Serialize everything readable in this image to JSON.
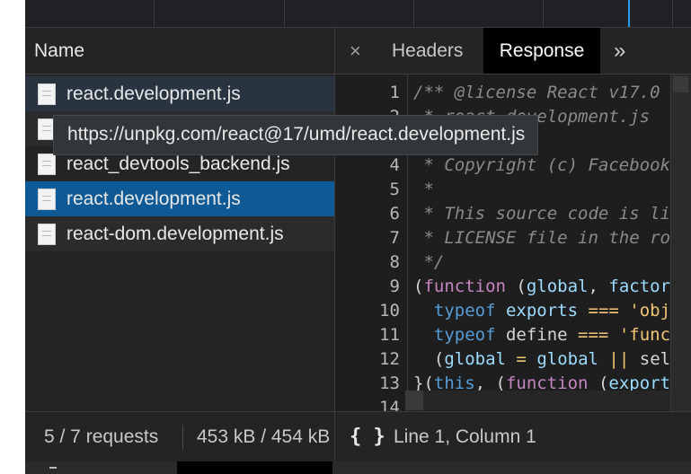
{
  "header": {
    "name_column": "Name"
  },
  "requests": [
    {
      "name": "react.development.js",
      "state": "hover"
    },
    {
      "name": "",
      "state": "normal"
    },
    {
      "name": "react_devtools_backend.js",
      "state": "normal"
    },
    {
      "name": "react.development.js",
      "state": "selected"
    },
    {
      "name": "react-dom.development.js",
      "state": "normal"
    }
  ],
  "tooltip": {
    "text": "https://unpkg.com/react@17/umd/react.development.js"
  },
  "tabs": {
    "close": "×",
    "items": [
      {
        "label": "Headers",
        "active": false
      },
      {
        "label": "Response",
        "active": true
      }
    ],
    "more": "»"
  },
  "code": {
    "line_numbers": [
      "1",
      "2",
      "3",
      "4",
      "5",
      "6",
      "7",
      "8",
      "9",
      "10",
      "11",
      "12",
      "13",
      "14"
    ],
    "lines": [
      "/** @license React v17.0",
      " * react.development.js",
      "",
      " * Copyright (c) Facebook",
      " *",
      " * This source code is lic",
      " * LICENSE file in the roo",
      " */",
      "(function (global, factory",
      "  typeof exports === 'obje",
      "  typeof define === 'funct",
      "  (global = global || self",
      "}(this, (function (exports",
      ""
    ]
  },
  "status": {
    "request_count": "5 / 7 requests",
    "transfer": "453 kB / 454 kB",
    "pretty_print": "{ }",
    "cursor_position": "Line 1, Column 1"
  },
  "colors": {
    "background": "#242424",
    "selected_row": "#0e5a96",
    "active_tab": "#000000",
    "waterfall_marker": "#2a9bf2"
  },
  "icons": {
    "file": "file-icon",
    "close": "close-icon",
    "more": "chevron-double-right-icon",
    "pretty_print": "braces-icon"
  }
}
